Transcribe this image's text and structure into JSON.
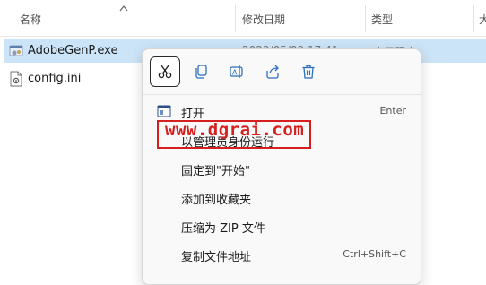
{
  "columns": {
    "name": "名称",
    "date": "修改日期",
    "type": "类型",
    "size": "大"
  },
  "files": [
    {
      "name": "AdobeGenP.exe",
      "date": "2023/05/09 17:41",
      "type": "应用程序"
    },
    {
      "name": "config.ini"
    }
  ],
  "quick_actions": [
    {
      "name": "cut",
      "icon": "scissors-icon"
    },
    {
      "name": "copy",
      "icon": "copy-icon"
    },
    {
      "name": "rename",
      "icon": "rename-icon"
    },
    {
      "name": "share",
      "icon": "share-icon"
    },
    {
      "name": "delete",
      "icon": "trash-icon"
    }
  ],
  "menu_items": [
    {
      "label": "打开",
      "shortcut": "Enter",
      "icon": "app-window-icon"
    },
    {
      "label": "以管理员身份运行",
      "shortcut": "",
      "icon": ""
    },
    {
      "label": "固定到\"开始\"",
      "shortcut": "",
      "icon": ""
    },
    {
      "label": "添加到收藏夹",
      "shortcut": "",
      "icon": ""
    },
    {
      "label": "压缩为 ZIP 文件",
      "shortcut": "",
      "icon": ""
    },
    {
      "label": "复制文件地址",
      "shortcut": "Ctrl+Shift+C",
      "icon": ""
    }
  ],
  "watermark": {
    "text": "www.dgrai.com"
  },
  "colors": {
    "selection": "#cce4f7",
    "watermark": "#d62020"
  }
}
